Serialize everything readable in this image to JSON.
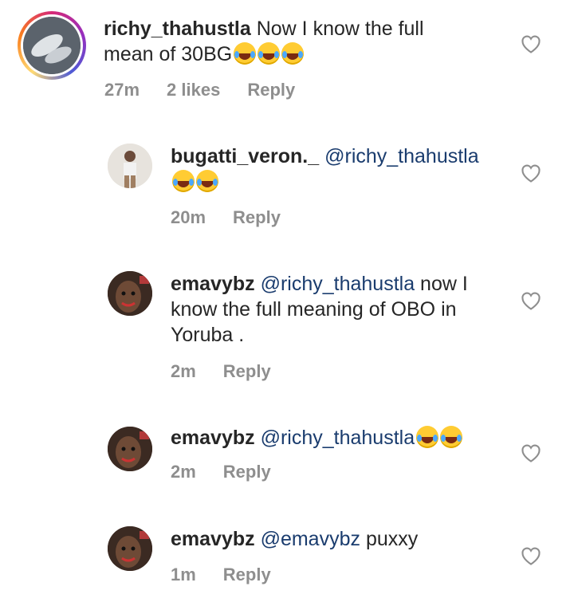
{
  "comments": [
    {
      "username": "richy_thahustla",
      "mention": "",
      "body": " Now I know the full mean of 30BG",
      "emojis": [
        "😂",
        "😂",
        "😂"
      ],
      "time": "27m",
      "likes": "2 likes",
      "reply": "Reply"
    },
    {
      "username": "bugatti_veron._",
      "mention": "@richy_thahustla",
      "body": "",
      "emojis": [
        "😂",
        "😂"
      ],
      "time": "20m",
      "reply": "Reply"
    },
    {
      "username": "emavybz",
      "mention": "@richy_thahustla",
      "body": " now I know the full meaning of OBO in Yoruba .",
      "emojis": [],
      "time": "2m",
      "reply": "Reply"
    },
    {
      "username": "emavybz",
      "mention": "@richy_thahustla",
      "body": "",
      "emojis": [
        "😂",
        "😂"
      ],
      "time": "2m",
      "reply": "Reply"
    },
    {
      "username": "emavybz",
      "mention": "@emavybz",
      "body": " puxxy",
      "emojis": [],
      "time": "1m",
      "reply": "Reply"
    }
  ],
  "icons": {
    "like": "heart-outline-icon",
    "emoji": "face-with-tears-of-joy"
  },
  "colors": {
    "text": "#262626",
    "meta": "#8e8e8e",
    "mention": "#1a3c6e",
    "story_ring": "#d62976"
  }
}
